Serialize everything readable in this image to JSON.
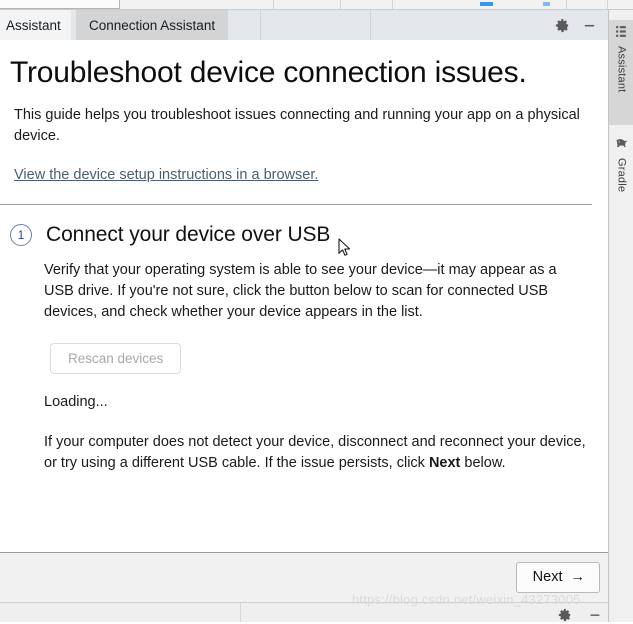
{
  "window": {
    "tabs": [
      {
        "label": "Assistant",
        "selected": false
      },
      {
        "label": "Connection Assistant",
        "selected": true
      }
    ],
    "tools": [
      {
        "name": "gear-icon",
        "title": "Settings"
      },
      {
        "name": "minimize-icon",
        "title": "Hide"
      }
    ]
  },
  "right_rail": {
    "items": [
      {
        "label": "Assistant",
        "icon": "grid-icon",
        "active": true
      },
      {
        "label": "Gradle",
        "icon": "elephant-icon",
        "active": false
      }
    ]
  },
  "main": {
    "title": "Troubleshoot device connection issues.",
    "intro": "This guide helps you troubleshoot issues connecting and running your app on a physical device.",
    "setup_link": "View the device setup instructions in a browser.",
    "step": {
      "number": "1",
      "title": "Connect your device over USB",
      "body": "Verify that your operating system is able to see your device—it may appear as a USB drive. If you're not sure, click the button below to scan for connected USB devices, and check whether your device appears in the list.",
      "rescan_label": "Rescan devices",
      "loading_label": "Loading...",
      "hint_before": "If your computer does not detect your device, disconnect and reconnect your device, or try using a different USB cable. If the issue persists, click ",
      "hint_bold": "Next",
      "hint_after": " below."
    }
  },
  "footer": {
    "next_label": "Next",
    "next_arrow": "→"
  },
  "bottom_strip": {
    "tools": [
      {
        "name": "gear-icon"
      },
      {
        "name": "minimize-icon"
      }
    ]
  },
  "watermark": "https://blog.csdn.net/weixin_43273005",
  "colors": {
    "accent_blue": "#2b44a8",
    "link": "#4b5d72",
    "tab_selected_bg": "#d2d4d6",
    "tabstrip_bg": "#e3e6ea",
    "footer_bg": "#f1f1f1"
  }
}
